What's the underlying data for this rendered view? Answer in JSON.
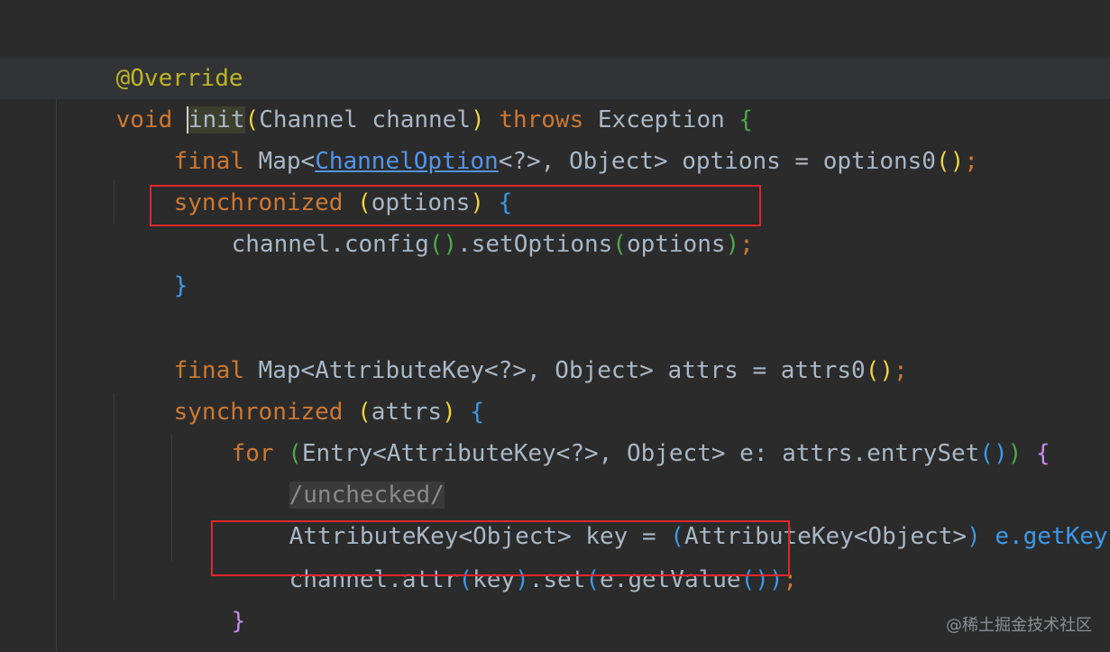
{
  "editor": {
    "lines": [
      {
        "id": "l1",
        "text": "@Override"
      },
      {
        "id": "l2",
        "text": "void init(Channel channel) throws Exception {"
      },
      {
        "id": "l3",
        "text": "final Map<ChannelOption<?>, Object> options = options0();"
      },
      {
        "id": "l4",
        "text": "synchronized (options) {"
      },
      {
        "id": "l5",
        "text": "channel.config().setOptions(options);"
      },
      {
        "id": "l6",
        "text": "}"
      },
      {
        "id": "l7",
        "text": ""
      },
      {
        "id": "l8",
        "text": "final Map<AttributeKey<?>, Object> attrs = attrs0();"
      },
      {
        "id": "l9",
        "text": "synchronized (attrs) {"
      },
      {
        "id": "l10",
        "text": "for (Entry<AttributeKey<?>, Object> e: attrs.entrySet()) {"
      },
      {
        "id": "l11",
        "text": "/unchecked/"
      },
      {
        "id": "l12",
        "text": "AttributeKey<Object> key = (AttributeKey<Object>) e.getKey();"
      },
      {
        "id": "l13",
        "text": "channel.attr(key).set(e.getValue());"
      },
      {
        "id": "l14",
        "text": "}"
      },
      {
        "id": "l15",
        "text": "}"
      }
    ],
    "tokens": {
      "override": "@Override",
      "void": "void",
      "init": "init",
      "lp1": "(",
      "channel_type": "Channel",
      "channel_param": " channel",
      "rp1": ")",
      "throws": " throws ",
      "exception": "Exception",
      "open_brace1": " {",
      "final": "final",
      "map_lt": " Map<",
      "channel_option": "ChannelOption",
      "generic_q": "<?>",
      "object_gt": ", Object>",
      "options_assign": " options = options0",
      "empty_call": "()",
      "semicolon": ";",
      "synchronized": "synchronized",
      "lp_options": " (",
      "options_word": "options",
      "rp_brace": ") ",
      "brace_open": "{",
      "brace_close": "}",
      "channel_config": "channel.config",
      "set_options": ".setOptions",
      "attribute_key": "AttributeKey",
      "attrs_assign": " attrs = attrs0",
      "attrs_word": "attrs",
      "for": "for",
      "entry": "Entry<",
      "e_colon": " e: attrs.entrySet",
      "unchecked_comment": "/unchecked/",
      "attr_key_obj": "AttributeKey<Object>",
      "key_assign": " key = ",
      "cast_close": ") e.getKey",
      "channel_attr": "channel.attr",
      "key_word": "key",
      "set_call": ".set",
      "e_getvalue": "e.getValue"
    }
  },
  "watermark": "@稀土掘金技术社区",
  "colors": {
    "background": "#2b2b2b",
    "keyword": "#cc7832",
    "annotation": "#bbb529",
    "highlight_box": "#e0262e",
    "link": "#5394ec"
  }
}
